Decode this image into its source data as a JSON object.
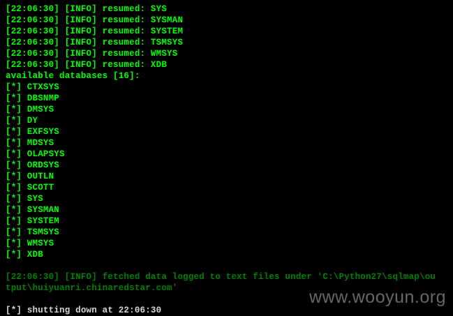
{
  "colors": {
    "background": "#000000",
    "bright_green": "#00ff00",
    "dim_green": "#008000",
    "white": "#d6d6d6"
  },
  "lines": [
    "[22:06:30] [INFO] resumed: SYS",
    "[22:06:30] [INFO] resumed: SYSMAN",
    "[22:06:30] [INFO] resumed: SYSTEM",
    "[22:06:30] [INFO] resumed: TSMSYS",
    "[22:06:30] [INFO] resumed: WMSYS",
    "[22:06:30] [INFO] resumed: XDB",
    "available databases [16]:",
    "[*] CTXSYS",
    "[*] DBSNMP",
    "[*] DMSYS",
    "[*] DY",
    "[*] EXFSYS",
    "[*] MDSYS",
    "[*] OLAPSYS",
    "[*] ORDSYS",
    "[*] OUTLN",
    "[*] SCOTT",
    "[*] SYS",
    "[*] SYSMAN",
    "[*] SYSTEM",
    "[*] TSMSYS",
    "[*] WMSYS",
    "[*] XDB",
    "",
    "[22:06:30] [INFO] fetched data logged to text files under 'C:\\Python27\\sqlmap\\ou",
    "tput\\huiyuanri.chinaredstar.com'",
    "",
    "[*] shutting down at 22:06:30"
  ],
  "watermark": "www.wooyun.org"
}
